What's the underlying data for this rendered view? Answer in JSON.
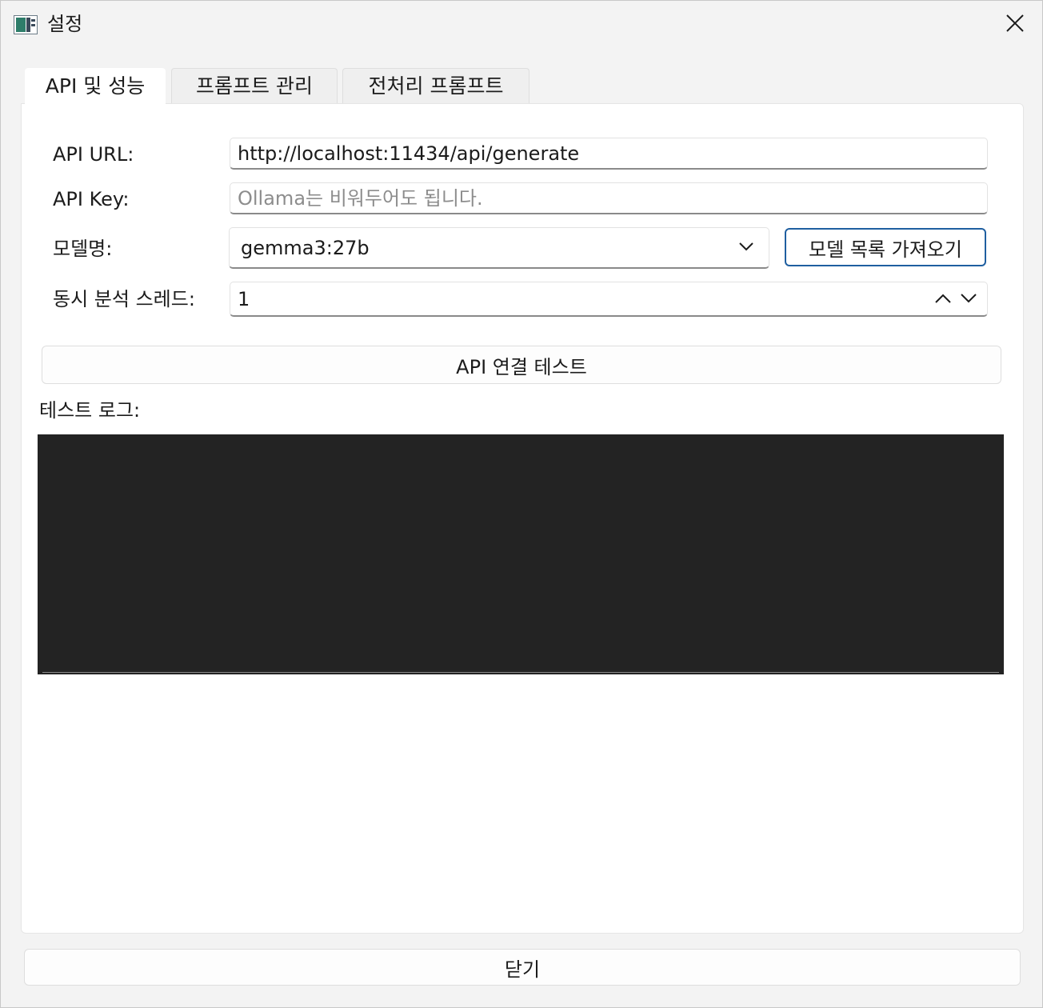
{
  "window": {
    "title": "설정",
    "app_icon": "app-window-icon",
    "close_icon": "close-icon"
  },
  "tabs": [
    {
      "label": "API 및 성능",
      "active": true
    },
    {
      "label": "프롬프트 관리",
      "active": false
    },
    {
      "label": "전처리 프롬프트",
      "active": false
    }
  ],
  "form": {
    "api_url_label": "API URL:",
    "api_url_value": "http://localhost:11434/api/generate",
    "api_key_label": "API Key:",
    "api_key_placeholder": "Ollama는 비워두어도 됩니다.",
    "model_label": "모델명:",
    "model_value": "gemma3:27b",
    "fetch_models_label": "모델 목록 가져오기",
    "threads_label": "동시 분석 스레드:",
    "threads_value": "1"
  },
  "test_button_label": "API 연결 테스트",
  "log_label": "테스트 로그:",
  "close_button_label": "닫기",
  "colors": {
    "accent": "#1f5fa0",
    "log_background": "#232323",
    "window_background": "#f3f3f3"
  }
}
